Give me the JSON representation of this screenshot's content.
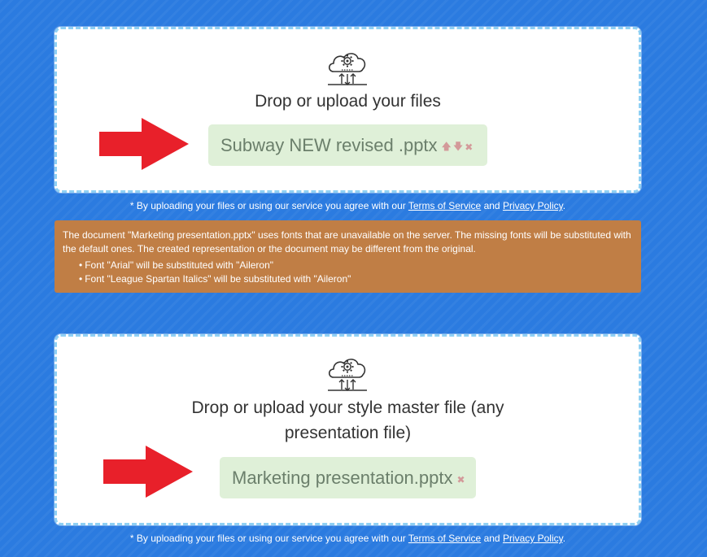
{
  "upload_main": {
    "icon": "cloud-gear-icon",
    "title": "Drop or upload your files",
    "file_name": "Subway NEW revised .pptx",
    "move_up_icon": "arrow-up-icon",
    "move_down_icon": "arrow-down-icon",
    "remove_icon": "close-icon"
  },
  "terms": {
    "prefix": "* By uploading your files or using our service you agree with our ",
    "terms_link": "Terms of Service",
    "and": " and ",
    "privacy_link": "Privacy Policy",
    "suffix": "."
  },
  "warning": {
    "message": "The document \"Marketing presentation.pptx\" uses fonts that are unavailable on the server. The missing fonts will be substituted with the default ones. The created representation or the document may be different from the original.",
    "items": [
      "Font \"Arial\" will be substituted with \"Aileron\"",
      "Font \"League Spartan Italics\" will be substituted with \"Aileron\""
    ],
    "color": "#c07e45"
  },
  "upload_style": {
    "icon": "cloud-gear-icon",
    "title": "Drop or upload your style master file (any presentation file)",
    "file_name": "Marketing presentation.pptx",
    "remove_icon": "close-icon"
  },
  "colors": {
    "background": "#2b7be0",
    "chip": "#dff0d8",
    "dashed_border": "#8fd0f4",
    "annotation_arrow": "#e8202a"
  }
}
